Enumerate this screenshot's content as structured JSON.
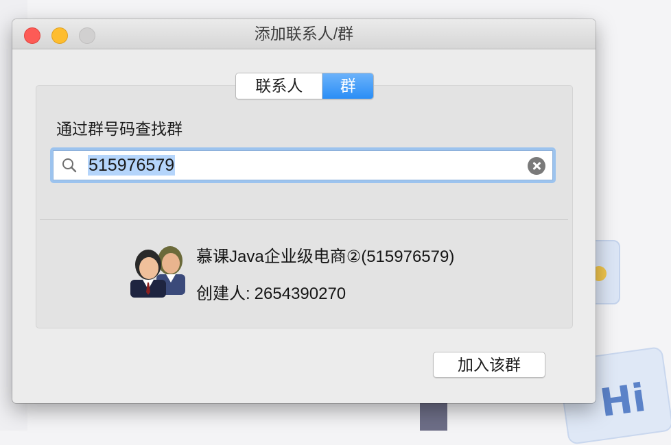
{
  "window": {
    "title": "添加联系人/群"
  },
  "tabs": [
    {
      "label": "联系人",
      "selected": false
    },
    {
      "label": "群",
      "selected": true
    }
  ],
  "search": {
    "label": "通过群号码查找群",
    "value": "515976579",
    "icon": "search-icon",
    "clear_icon": "clear-icon"
  },
  "result": {
    "name": "慕课Java企业级电商②(515976579)",
    "creator_label": "创建人:",
    "creator_id": "2654390270",
    "avatar_icon": "group-avatar-icon"
  },
  "actions": {
    "join_label": "加入该群"
  },
  "background": {
    "text": "Hi"
  },
  "colors": {
    "accent": "#2a8ef6",
    "close": "#fd5b56",
    "minimize": "#febd2f",
    "zoom": "#d1d0d0"
  }
}
